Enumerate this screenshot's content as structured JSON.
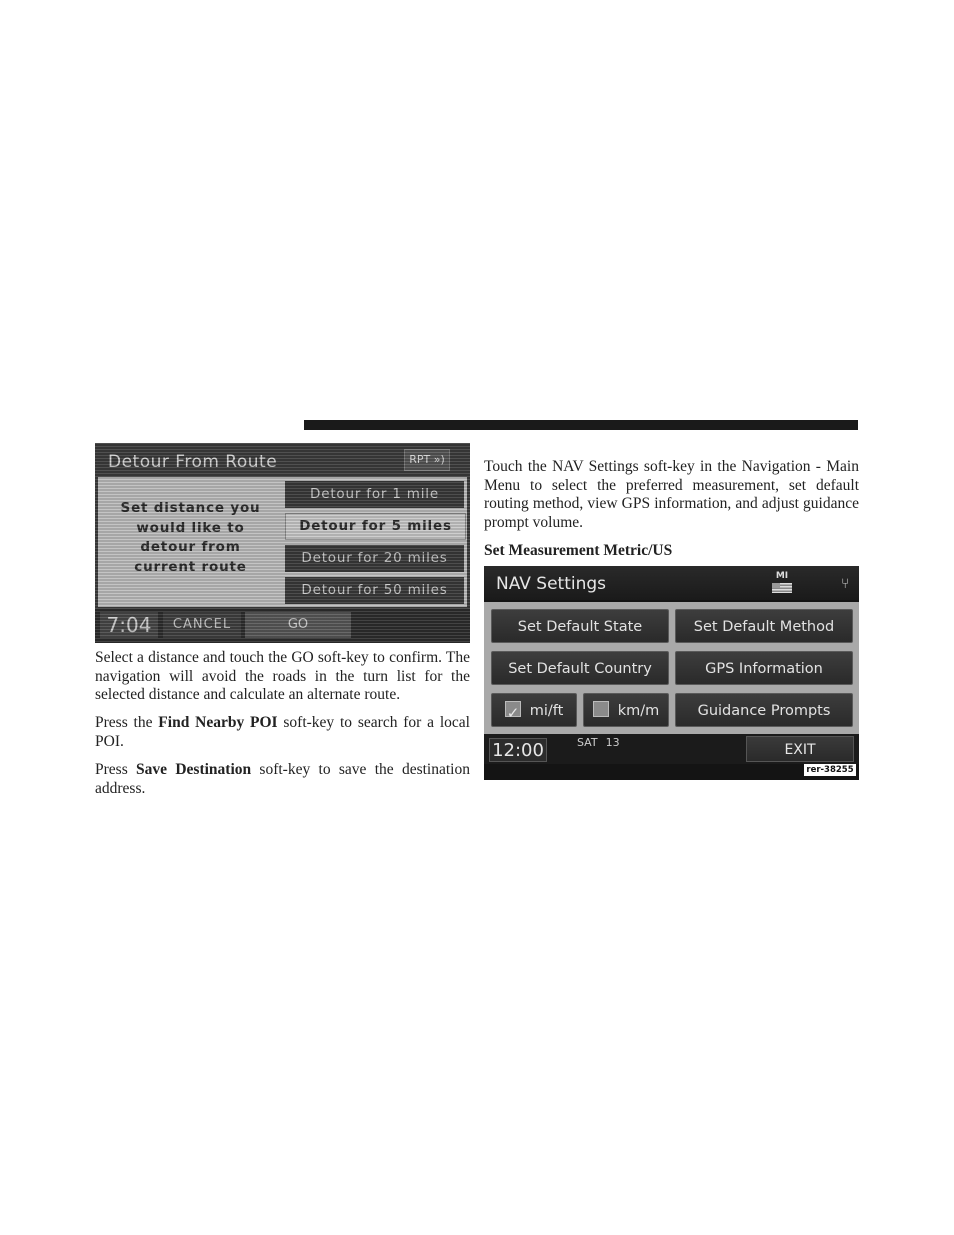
{
  "detour_screen": {
    "title": "Detour From Route",
    "rpt_label": "RPT »)",
    "prompt_lines": [
      "Set distance you",
      "would like to",
      "detour from",
      "current route"
    ],
    "options": [
      {
        "label": "Detour for 1 mile",
        "selected": false
      },
      {
        "label": "Detour for 5 miles",
        "selected": true
      },
      {
        "label": "Detour for 20 miles",
        "selected": false
      },
      {
        "label": "Detour for 50 miles",
        "selected": false
      }
    ],
    "clock": "7:04",
    "cancel_label": "CANCEL",
    "go_label": "GO"
  },
  "left_text": {
    "para1": "Select a distance and touch the GO soft-key to confirm. The navigation will avoid the roads in the turn list for the selected distance and calculate an alternate route.",
    "para2_prefix": "Press the ",
    "para2_bold": "Find Nearby POI",
    "para2_suffix": " soft-key to search for a local POI.",
    "para3_prefix": "Press ",
    "para3_bold": "Save Destination",
    "para3_suffix": " soft-key to save the destination address."
  },
  "right_text": {
    "para1": "Touch the NAV Settings soft-key in the Navigation - Main Menu to select the preferred measurement, set default routing method, view GPS information, and adjust guidance prompt volume.",
    "heading": "Set Measurement Metric/US"
  },
  "nav_screen": {
    "title": "NAV Settings",
    "state_badge": "MI",
    "buttons": {
      "set_default_state": "Set Default State",
      "set_default_method": "Set Default Method",
      "set_default_country": "Set Default Country",
      "gps_information": "GPS Information",
      "mi_ft": "mi/ft",
      "km_m": "km/m",
      "guidance_prompts": "Guidance Prompts"
    },
    "mi_ft_checked": true,
    "km_m_checked": false,
    "clock": "12:00",
    "day": "SAT",
    "date": "13",
    "exit_label": "EXIT",
    "figure_code": "rer-38255"
  }
}
